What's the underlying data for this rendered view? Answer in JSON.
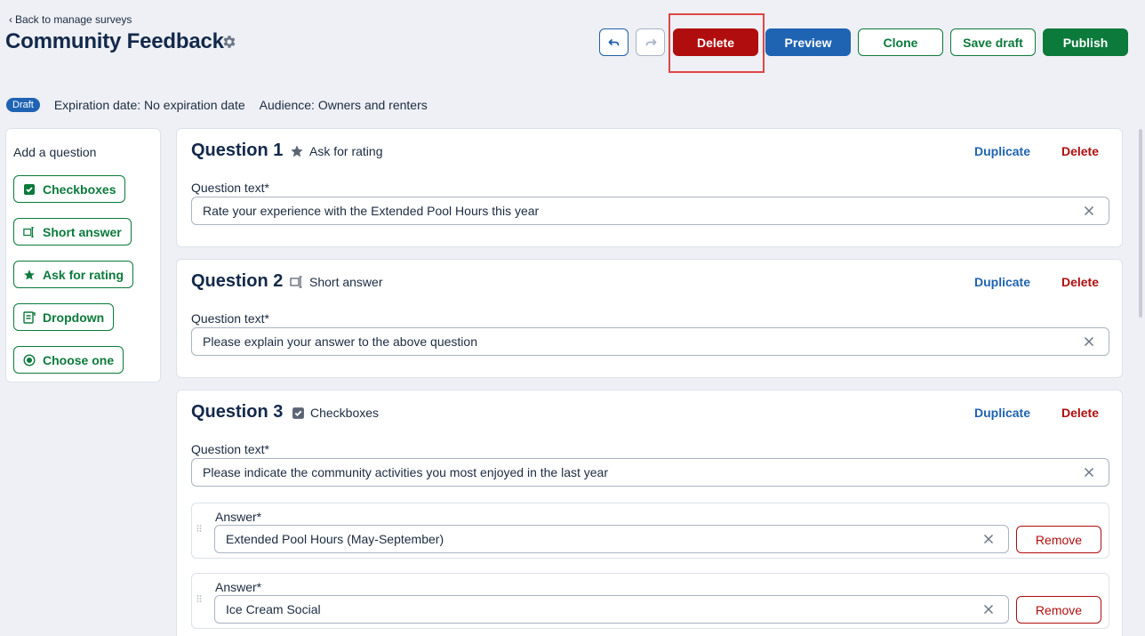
{
  "header": {
    "back_label": "Back to manage surveys",
    "title": "Community Feedback",
    "toolbar": {
      "delete_label": "Delete",
      "preview_label": "Preview",
      "clone_label": "Clone",
      "save_draft_label": "Save draft",
      "publish_label": "Publish"
    }
  },
  "meta": {
    "status_badge": "Draft",
    "expiration": "Expiration date: No expiration date",
    "audience": "Audience: Owners and renters"
  },
  "sidebar": {
    "title": "Add a question",
    "items": [
      {
        "label": "Checkboxes",
        "icon": "checkbox-icon"
      },
      {
        "label": "Short answer",
        "icon": "short-answer-icon"
      },
      {
        "label": "Ask for rating",
        "icon": "star-icon"
      },
      {
        "label": "Dropdown",
        "icon": "dropdown-icon"
      },
      {
        "label": "Choose one",
        "icon": "radio-icon"
      }
    ]
  },
  "questions": [
    {
      "title": "Question 1",
      "type_label": "Ask for rating",
      "duplicate_label": "Duplicate",
      "delete_label": "Delete",
      "text_label": "Question text*",
      "text_value": "Rate your experience with the Extended Pool Hours this year"
    },
    {
      "title": "Question 2",
      "type_label": "Short answer",
      "duplicate_label": "Duplicate",
      "delete_label": "Delete",
      "text_label": "Question text*",
      "text_value": "Please explain your answer to the above question"
    },
    {
      "title": "Question 3",
      "type_label": "Checkboxes",
      "duplicate_label": "Duplicate",
      "delete_label": "Delete",
      "text_label": "Question text*",
      "text_value": "Please indicate the community activities you most enjoyed in the last year",
      "answers": [
        {
          "label": "Answer*",
          "value": "Extended Pool Hours (May-September)",
          "remove_label": "Remove"
        },
        {
          "label": "Answer*",
          "value": "Ice Cream Social",
          "remove_label": "Remove"
        }
      ]
    }
  ],
  "colors": {
    "primary_blue": "#1f63b3",
    "danger_red": "#b00e0e",
    "success_green": "#0b7a3b",
    "title_navy": "#13294b",
    "background": "#eef0f5"
  }
}
